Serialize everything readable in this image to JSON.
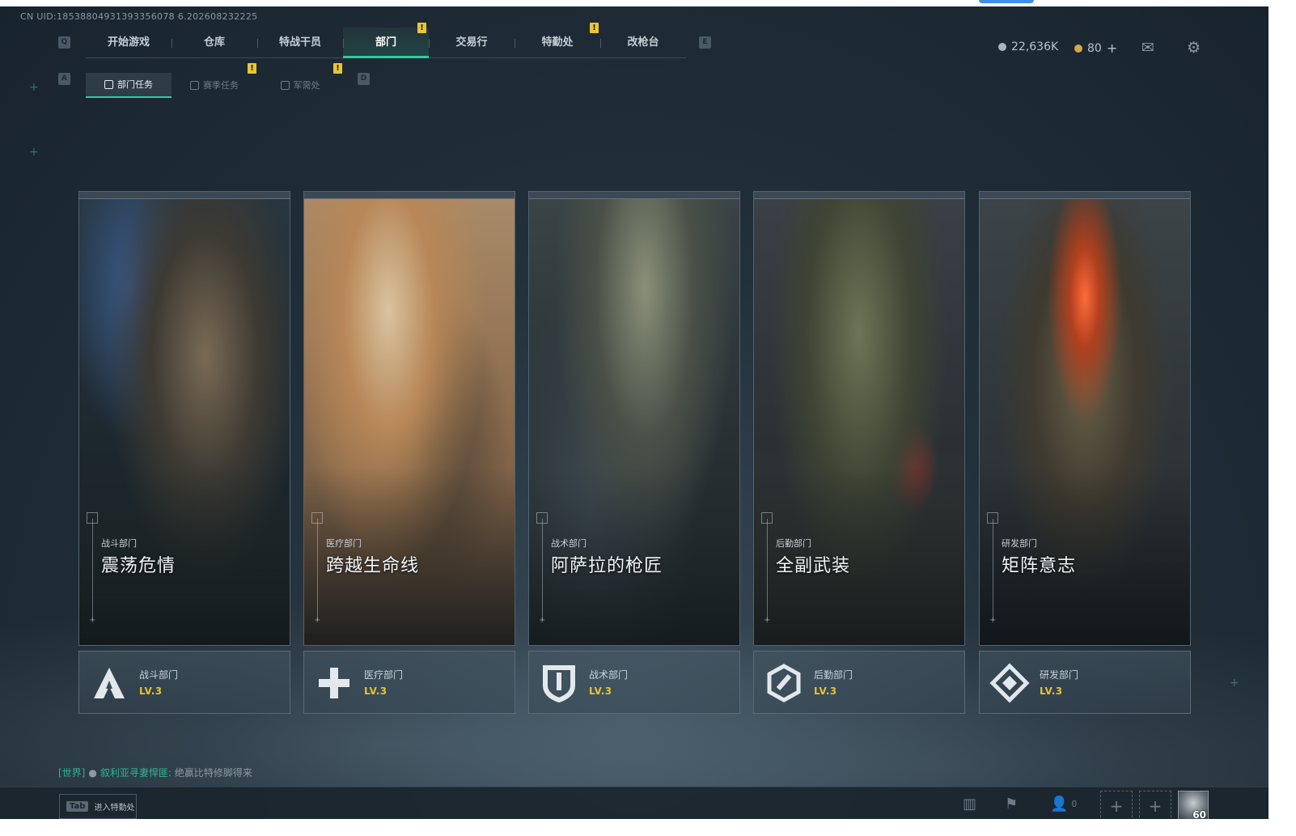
{
  "uid": "CN UID:18538804931393356078 6.202608232225",
  "keys": {
    "left_nav": "Q",
    "right_nav": "E",
    "sub_left": "A",
    "sub_right": "D"
  },
  "top_tabs": [
    {
      "label": "开始游戏",
      "active": false,
      "badge": ""
    },
    {
      "label": "仓库",
      "active": false,
      "badge": ""
    },
    {
      "label": "特战干员",
      "active": false,
      "badge": ""
    },
    {
      "label": "部门",
      "active": true,
      "badge": "!"
    },
    {
      "label": "交易行",
      "active": false,
      "badge": ""
    },
    {
      "label": "特勤处",
      "active": false,
      "badge": "!"
    },
    {
      "label": "改枪台",
      "active": false,
      "badge": ""
    }
  ],
  "sub_tabs": [
    {
      "label": "部门任务",
      "active": true,
      "badge": ""
    },
    {
      "label": "赛季任务",
      "active": false,
      "badge": "!"
    },
    {
      "label": "军需处",
      "active": false,
      "badge": "!"
    }
  ],
  "currency": {
    "money": "22,636K",
    "coins": "80",
    "add": "+"
  },
  "cards": [
    {
      "dept": "战斗部门",
      "title": "震荡危情",
      "level": "LV.3",
      "emblem": "combat-emblem-icon"
    },
    {
      "dept": "医疗部门",
      "title": "跨越生命线",
      "level": "LV.3",
      "emblem": "medical-emblem-icon"
    },
    {
      "dept": "战术部门",
      "title": "阿萨拉的枪匠",
      "level": "LV.3",
      "emblem": "tactical-emblem-icon"
    },
    {
      "dept": "后勤部门",
      "title": "全副武装",
      "level": "LV.3",
      "emblem": "logistics-emblem-icon"
    },
    {
      "dept": "研发部门",
      "title": "矩阵意志",
      "level": "LV.3",
      "emblem": "research-emblem-icon"
    }
  ],
  "chat": {
    "channel": "[世界]",
    "name": "叙利亚寻妻悍匪:",
    "message": "绝赢比特修脚得来"
  },
  "bottom": {
    "tab_key": "Tab",
    "tab_text": "进入特勤处",
    "friends": "0",
    "avatar_level": "60"
  },
  "colors": {
    "accent": "#33c9a2",
    "badge": "#e8c53a",
    "level": "#e6c234"
  }
}
